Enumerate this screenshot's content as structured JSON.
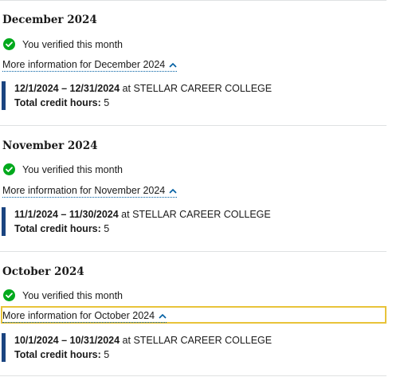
{
  "months": [
    {
      "title": "December 2024",
      "status": "You verified this month",
      "more_link": "More information for December 2024",
      "record": {
        "dates": "12/1/2024 – 12/31/2024",
        "at": " at STELLAR CAREER COLLEGE",
        "hours_label": "Total credit hours:",
        "hours": "5"
      }
    },
    {
      "title": "November 2024",
      "status": "You verified this month",
      "more_link": "More information for November 2024",
      "record": {
        "dates": "11/1/2024 – 11/30/2024",
        "at": " at STELLAR CAREER COLLEGE",
        "hours_label": "Total credit hours:",
        "hours": "5"
      }
    },
    {
      "title": "October 2024",
      "status": "You verified this month",
      "more_link": "More information for October 2024",
      "record": {
        "dates": "10/1/2024 – 10/31/2024",
        "at": " at STELLAR CAREER COLLEGE",
        "hours_label": "Total credit hours:",
        "hours": "5"
      }
    }
  ],
  "colors": {
    "accent_bar": "#1a4480",
    "success": "#00a91c",
    "focus": "#e8c33a",
    "link_dotted": "#005ea2"
  },
  "icons": {
    "status": "check-circle-icon",
    "chevron": "chevron-up-icon"
  }
}
